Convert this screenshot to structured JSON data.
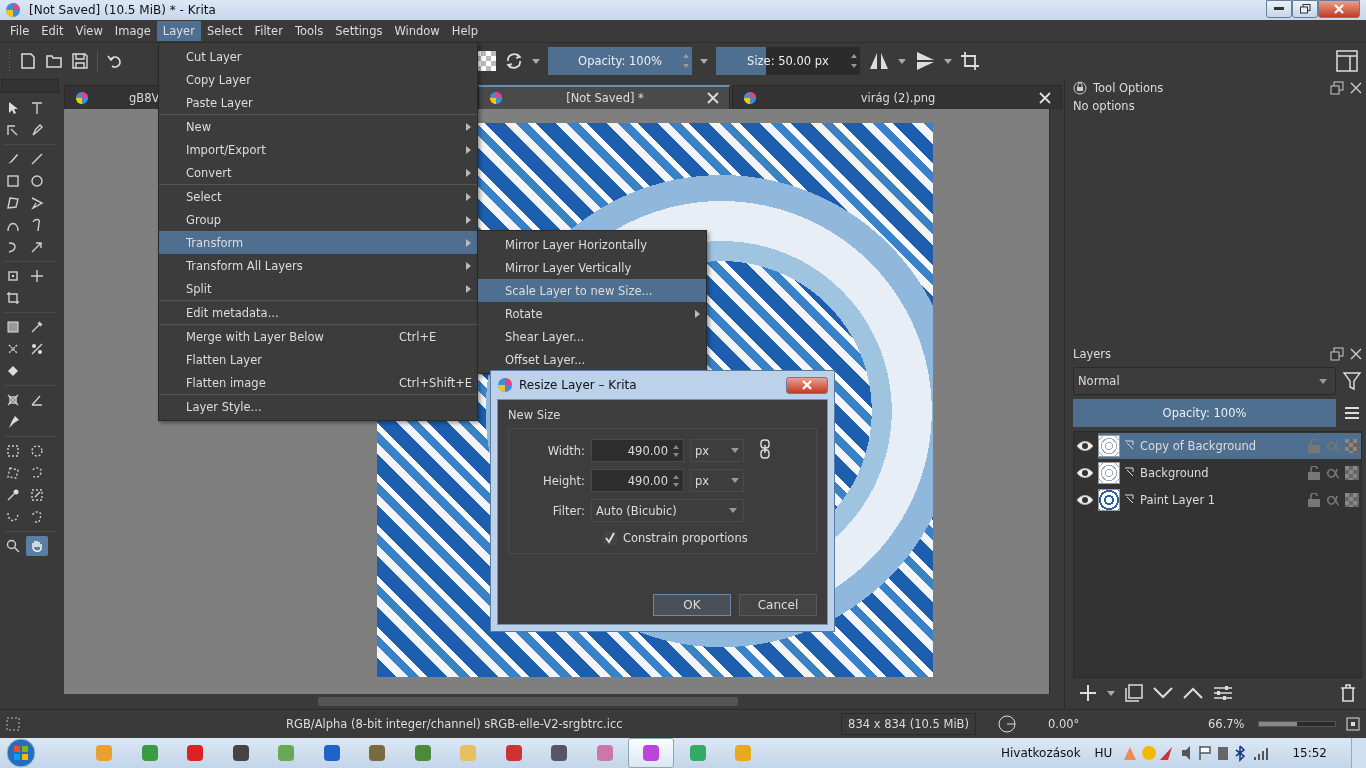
{
  "window": {
    "title": "[Not Saved]  (10.5 MiB)  * - Krita"
  },
  "menubar": [
    {
      "label": "File",
      "selected": false
    },
    {
      "label": "Edit",
      "selected": false
    },
    {
      "label": "View",
      "selected": false
    },
    {
      "label": "Image",
      "selected": false
    },
    {
      "label": "Layer",
      "selected": true
    },
    {
      "label": "Select",
      "selected": false
    },
    {
      "label": "Filter",
      "selected": false
    },
    {
      "label": "Tools",
      "selected": false
    },
    {
      "label": "Settings",
      "selected": false
    },
    {
      "label": "Window",
      "selected": false
    },
    {
      "label": "Help",
      "selected": false
    }
  ],
  "toolbar": {
    "opacity": {
      "label": "Opacity: 100%",
      "level": 1
    },
    "size": {
      "label": "Size: 50.00 px",
      "level": 0.35
    }
  },
  "document_tabs": [
    {
      "label": "gB8V",
      "selected": false
    },
    {
      "label": "[Not Saved]  *",
      "selected": true
    },
    {
      "label": "virág (2).png",
      "selected": false
    }
  ],
  "toolbox": {
    "tools": [
      {
        "selected": false
      },
      {
        "selected": false
      },
      {
        "selected": false
      },
      {
        "selected": false
      },
      {
        "selected": false
      },
      {
        "selected": false
      },
      {
        "selected": false
      },
      {
        "selected": false
      },
      {
        "selected": false
      },
      {
        "selected": false
      },
      {
        "selected": false
      },
      {
        "selected": false
      },
      {
        "selected": false
      },
      {
        "selected": false
      },
      {
        "selected": false
      },
      {
        "selected": false
      },
      {
        "selected": false
      },
      {
        "selected": false
      },
      {
        "selected": false
      },
      {
        "selected": false
      },
      {
        "selected": false
      },
      {
        "selected": false
      },
      {
        "selected": false
      },
      {
        "selected": false
      },
      {
        "selected": false
      },
      {
        "selected": false
      },
      {
        "selected": false
      },
      {
        "selected": false
      },
      {
        "selected": false
      },
      {
        "selected": false
      },
      {
        "selected": false
      },
      {
        "selected": false
      },
      {
        "selected": false
      },
      {
        "selected": false
      },
      {
        "selected": true
      }
    ]
  },
  "layer_menu": {
    "groups": [
      [
        {
          "label": "Cut Layer",
          "submenu": false,
          "selected": false
        },
        {
          "label": "Copy Layer",
          "submenu": false,
          "selected": false
        },
        {
          "label": "Paste Layer",
          "submenu": false,
          "selected": false
        }
      ],
      [
        {
          "label": "New",
          "submenu": true,
          "selected": false
        },
        {
          "label": "Import/Export",
          "submenu": true,
          "selected": false
        },
        {
          "label": "Convert",
          "submenu": true,
          "selected": false
        }
      ],
      [
        {
          "label": "Select",
          "submenu": true,
          "selected": false
        },
        {
          "label": "Group",
          "submenu": true,
          "selected": false
        },
        {
          "label": "Transform",
          "submenu": true,
          "selected": true
        },
        {
          "label": "Transform All Layers",
          "submenu": true,
          "selected": false
        },
        {
          "label": "Split",
          "submenu": true,
          "selected": false
        }
      ],
      [
        {
          "label": "Edit metadata...",
          "submenu": false,
          "selected": false
        }
      ],
      [
        {
          "label": "Merge with Layer Below",
          "shortcut": "Ctrl+E",
          "submenu": false,
          "selected": false
        },
        {
          "label": "Flatten Layer",
          "submenu": false,
          "selected": false
        },
        {
          "label": "Flatten image",
          "shortcut": "Ctrl+Shift+E",
          "submenu": false,
          "selected": false
        }
      ],
      [
        {
          "label": "Layer Style...",
          "submenu": false,
          "selected": false
        }
      ]
    ]
  },
  "transform_submenu": [
    {
      "label": "Mirror Layer Horizontally",
      "submenu": false,
      "selected": false
    },
    {
      "label": "Mirror Layer Vertically",
      "submenu": false,
      "selected": false
    },
    {
      "label": "Scale Layer to new Size...",
      "submenu": false,
      "selected": true
    },
    {
      "label": "Rotate",
      "submenu": true,
      "selected": false
    },
    {
      "label": "Shear Layer...",
      "submenu": false,
      "selected": false
    },
    {
      "label": "Offset Layer...",
      "submenu": false,
      "selected": false
    }
  ],
  "dialog": {
    "title": "Resize Layer – Krita",
    "group": "New Size",
    "width": {
      "label": "Width:",
      "value": "490.00",
      "unit": "px"
    },
    "height": {
      "label": "Height:",
      "value": "490.00",
      "unit": "px"
    },
    "filter": {
      "label": "Filter:",
      "value": "Auto (Bicubic)"
    },
    "constrain": {
      "label": "Constrain proportions",
      "checked": true
    },
    "buttons": [
      "OK",
      "Cancel"
    ]
  },
  "tool_options": {
    "title": "Tool Options",
    "text": "No options"
  },
  "layers_panel": {
    "title": "Layers",
    "blend_mode": "Normal",
    "opacity": {
      "label": "Opacity:  100%",
      "level": 1
    },
    "layers": [
      {
        "name": "Copy of Background",
        "visible": true,
        "selected": true
      },
      {
        "name": "Background",
        "visible": true,
        "selected": false
      },
      {
        "name": "Paint Layer 1",
        "visible": true,
        "selected": false
      }
    ]
  },
  "status_bar": {
    "color_space": "RGB/Alpha (8-bit integer/channel)  sRGB-elle-V2-srgbtrc.icc",
    "dimensions": "834 x 834 (10.5 MiB)",
    "rotation": "0.00°",
    "zoom": "66.7%",
    "zoom_level": {
      "level": 0.5
    }
  },
  "taskbar": {
    "apps": [
      {
        "selected": false
      },
      {
        "selected": false
      },
      {
        "selected": false
      },
      {
        "selected": false
      },
      {
        "selected": false
      },
      {
        "selected": false
      },
      {
        "selected": false
      },
      {
        "selected": false
      },
      {
        "selected": false
      },
      {
        "selected": false
      },
      {
        "selected": false
      },
      {
        "selected": false
      },
      {
        "selected": true
      },
      {
        "selected": false
      },
      {
        "selected": false
      }
    ],
    "toolbar_label": "Hivatkozások",
    "language": "HU",
    "clock": "15:52"
  }
}
